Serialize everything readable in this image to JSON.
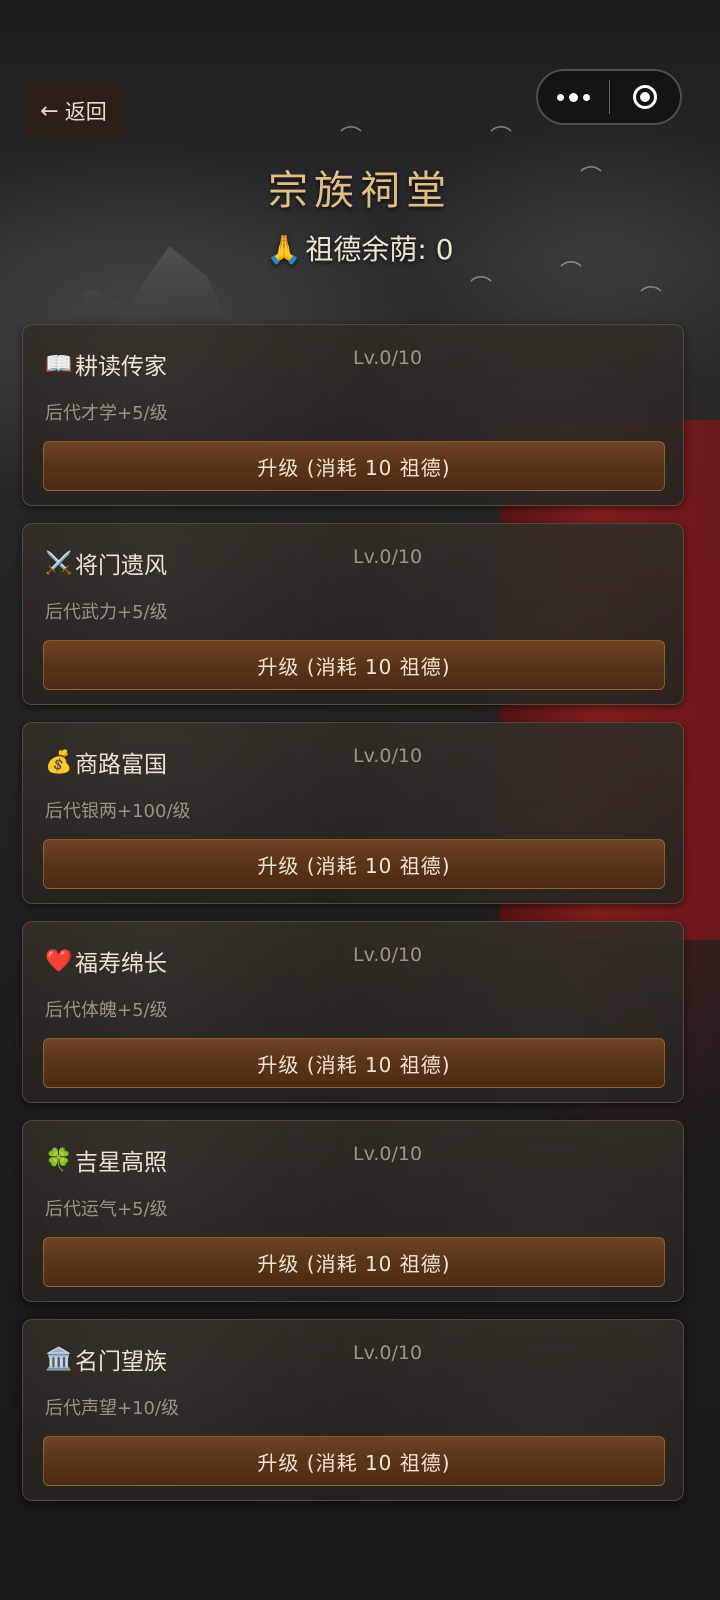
{
  "header": {
    "back_label": "返回",
    "title": "宗族祠堂",
    "merit_emoji": "🙏",
    "merit_text": "祖德余荫: 0"
  },
  "perks": [
    {
      "icon": "📖",
      "icon_name": "book-icon",
      "name": "耕读传家",
      "level": "Lv.0/10",
      "desc": "后代才学+5/级",
      "button": "升级 (消耗 10 祖德)"
    },
    {
      "icon": "⚔️",
      "icon_name": "crossed-swords-icon",
      "name": "将门遗风",
      "level": "Lv.0/10",
      "desc": "后代武力+5/级",
      "button": "升级 (消耗 10 祖德)"
    },
    {
      "icon": "💰",
      "icon_name": "money-bag-icon",
      "name": "商路富国",
      "level": "Lv.0/10",
      "desc": "后代银两+100/级",
      "button": "升级 (消耗 10 祖德)"
    },
    {
      "icon": "❤️",
      "icon_name": "heart-icon",
      "name": "福寿绵长",
      "level": "Lv.0/10",
      "desc": "后代体魄+5/级",
      "button": "升级 (消耗 10 祖德)"
    },
    {
      "icon": "🍀",
      "icon_name": "four-leaf-clover-icon",
      "name": "吉星高照",
      "level": "Lv.0/10",
      "desc": "后代运气+5/级",
      "button": "升级 (消耗 10 祖德)"
    },
    {
      "icon": "🏛️",
      "icon_name": "classical-building-icon",
      "name": "名门望族",
      "level": "Lv.0/10",
      "desc": "后代声望+10/级",
      "button": "升级 (消耗 10 祖德)"
    }
  ],
  "colors": {
    "title": "#e2be85",
    "button": "#5b3519",
    "card": "#2f2a25"
  }
}
